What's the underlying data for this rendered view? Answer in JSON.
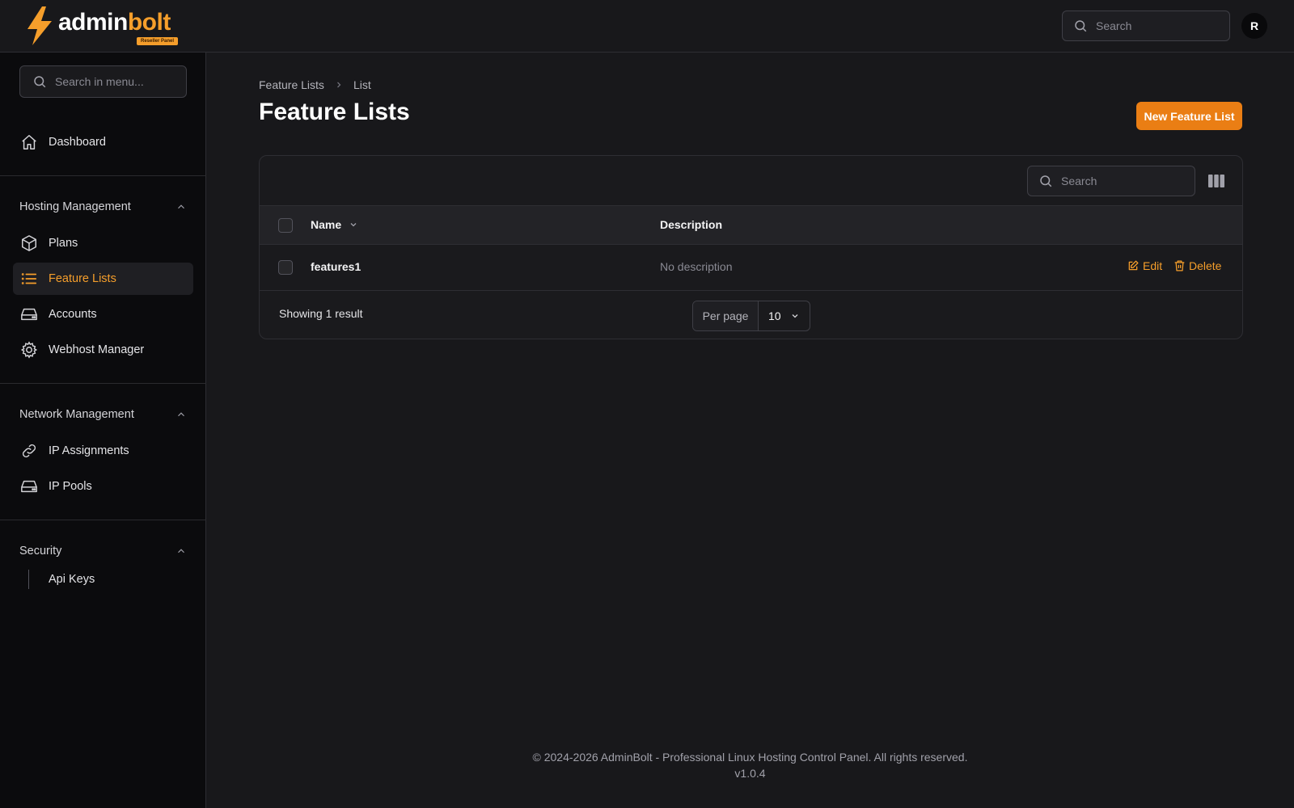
{
  "brand": {
    "name_part1": "admin",
    "name_part2": "bolt",
    "badge": "Reseller Panel",
    "accent": "#f59e2b"
  },
  "topbar": {
    "search_placeholder": "Search",
    "avatar_initial": "R"
  },
  "sidebar": {
    "search_placeholder": "Search in menu...",
    "dashboard": {
      "label": "Dashboard",
      "icon": "home-icon"
    },
    "groups": [
      {
        "title": "Hosting Management",
        "items": [
          {
            "label": "Plans",
            "icon": "cube-icon"
          },
          {
            "label": "Feature Lists",
            "icon": "list-icon",
            "active": true
          },
          {
            "label": "Accounts",
            "icon": "server-icon"
          },
          {
            "label": "Webhost Manager",
            "icon": "gear-icon"
          }
        ]
      },
      {
        "title": "Network Management",
        "items": [
          {
            "label": "IP Assignments",
            "icon": "link-icon"
          },
          {
            "label": "IP Pools",
            "icon": "server-icon"
          }
        ]
      },
      {
        "title": "Security",
        "items": [
          {
            "label": "Api Keys",
            "icon": ""
          }
        ]
      }
    ]
  },
  "main": {
    "breadcrumb": [
      "Feature Lists",
      "List"
    ],
    "title": "Feature Lists",
    "new_button": "New Feature List",
    "table": {
      "search_placeholder": "Search",
      "columns": [
        "Name",
        "Description"
      ],
      "rows": [
        {
          "name": "features1",
          "description": "No description"
        }
      ],
      "actions": {
        "edit": "Edit",
        "delete": "Delete"
      },
      "result_text": "Showing 1 result",
      "per_page_label": "Per page",
      "per_page_value": "10"
    }
  },
  "footer": {
    "copyright": "© 2024-2026 AdminBolt - Professional Linux Hosting Control Panel. All rights reserved.",
    "version": "v1.0.4"
  }
}
